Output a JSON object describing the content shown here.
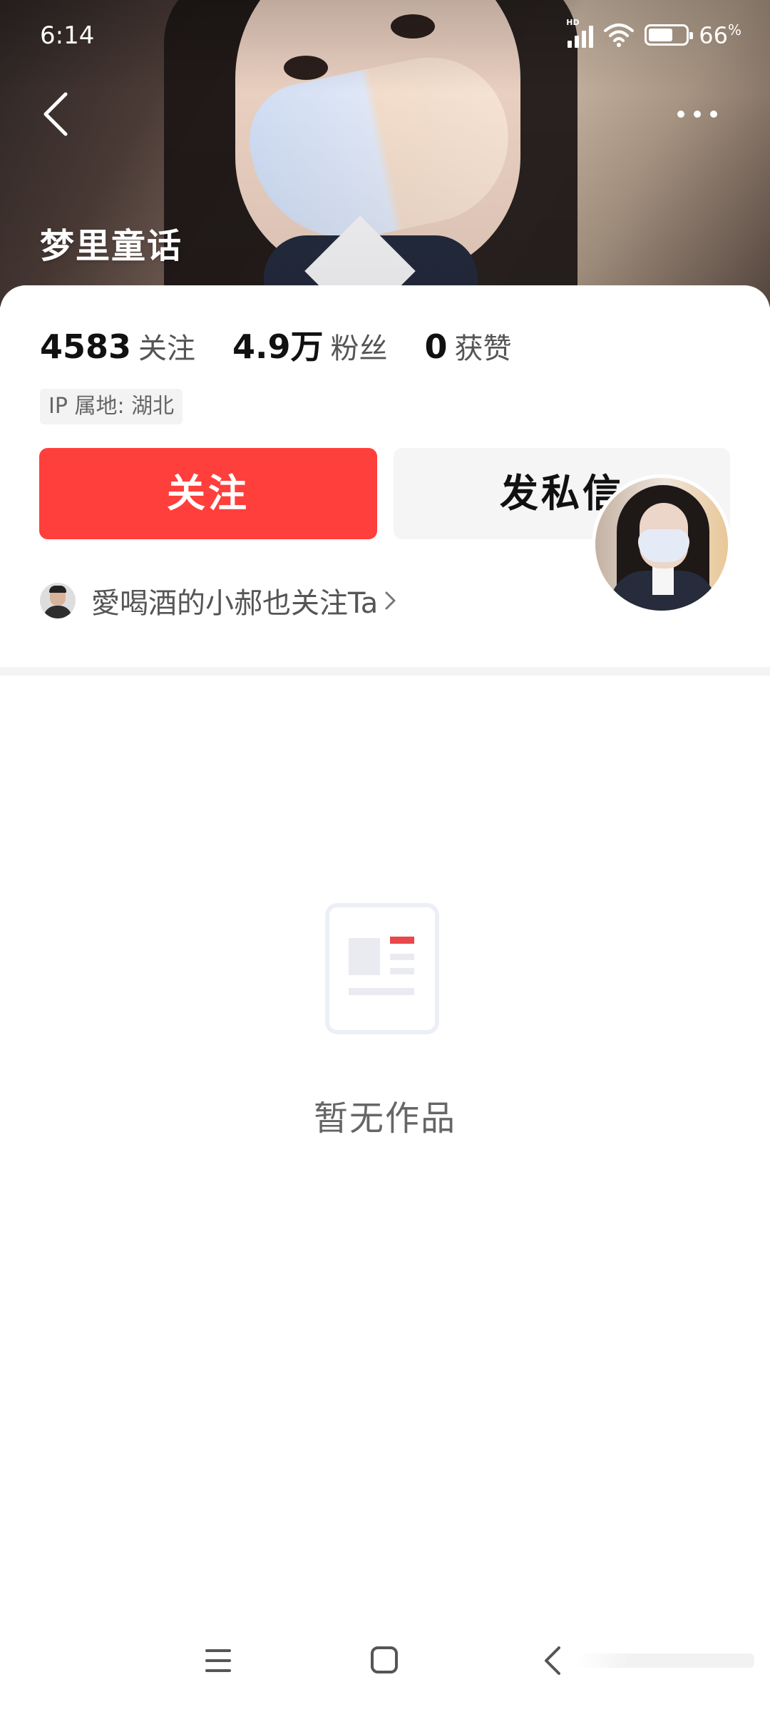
{
  "status_bar": {
    "time": "6:14",
    "network_badge": "HD",
    "battery_percent": "66",
    "battery_unit": "%",
    "battery_level": 0.66
  },
  "header": {
    "back_icon": "chevron-left-icon",
    "more_icon": "more-dots-icon",
    "profile_name": "梦里童话"
  },
  "stats": [
    {
      "value": "4583",
      "label": "关注"
    },
    {
      "value": "4.9万",
      "label": "粉丝"
    },
    {
      "value": "0",
      "label": "获赞"
    }
  ],
  "ip_location": "IP 属地: 湖北",
  "actions": {
    "follow_label": "关注",
    "message_label": "发私信",
    "follow_color": "#ff3f3b"
  },
  "mutual": {
    "text": "愛喝酒的小郝也关注Ta"
  },
  "empty_state": {
    "icon": "article-icon",
    "text": "暂无作品"
  },
  "nav_bar": {
    "menu_icon": "menu-icon",
    "home_icon": "home-square-icon",
    "back_icon": "nav-back-icon"
  }
}
